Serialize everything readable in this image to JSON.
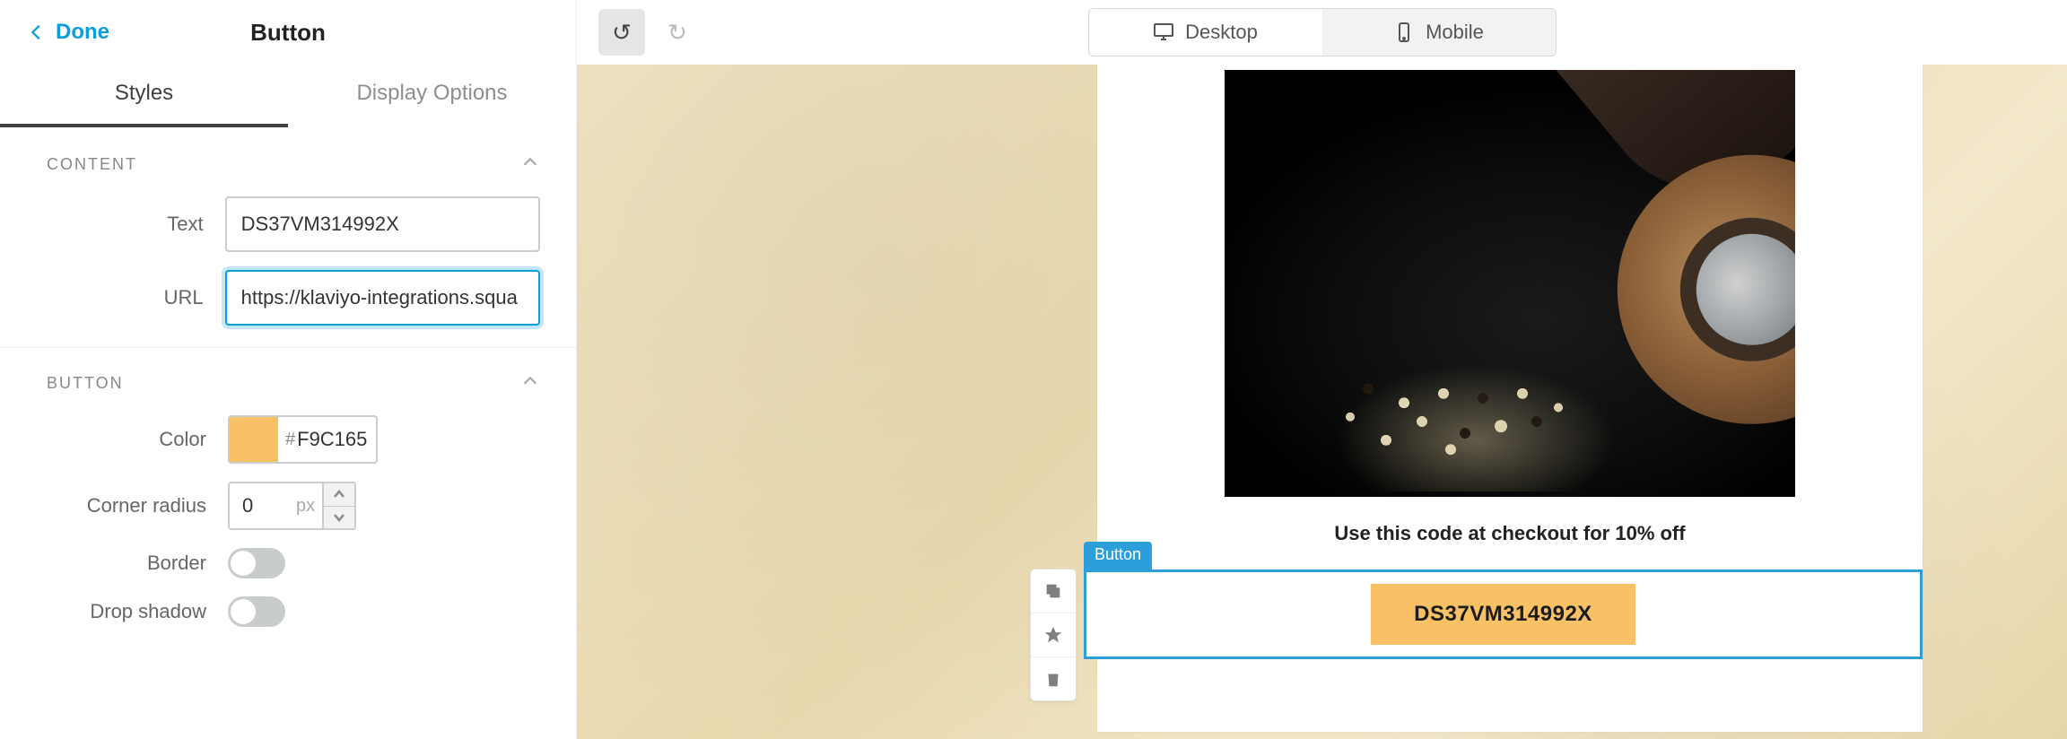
{
  "panel": {
    "done_label": "Done",
    "title": "Button",
    "tabs": {
      "styles": "Styles",
      "display_options": "Display Options"
    },
    "sections": {
      "content_title": "CONTENT",
      "button_title": "BUTTON"
    },
    "fields": {
      "text_label": "Text",
      "text_value": "DS37VM314992X",
      "url_label": "URL",
      "url_value": "https://klaviyo-integrations.squa",
      "color_label": "Color",
      "color_swatch": "#F9C165",
      "color_hex": "F9C165",
      "corner_label": "Corner radius",
      "corner_value": "0",
      "corner_unit": "px",
      "border_label": "Border",
      "drop_shadow_label": "Drop shadow"
    }
  },
  "toolbar": {
    "devices": {
      "desktop": "Desktop",
      "mobile": "Mobile"
    }
  },
  "preview": {
    "promo_text": "Use this code at checkout for 10% off",
    "button_text": "DS37VM314992X",
    "block_tag": "Button"
  }
}
